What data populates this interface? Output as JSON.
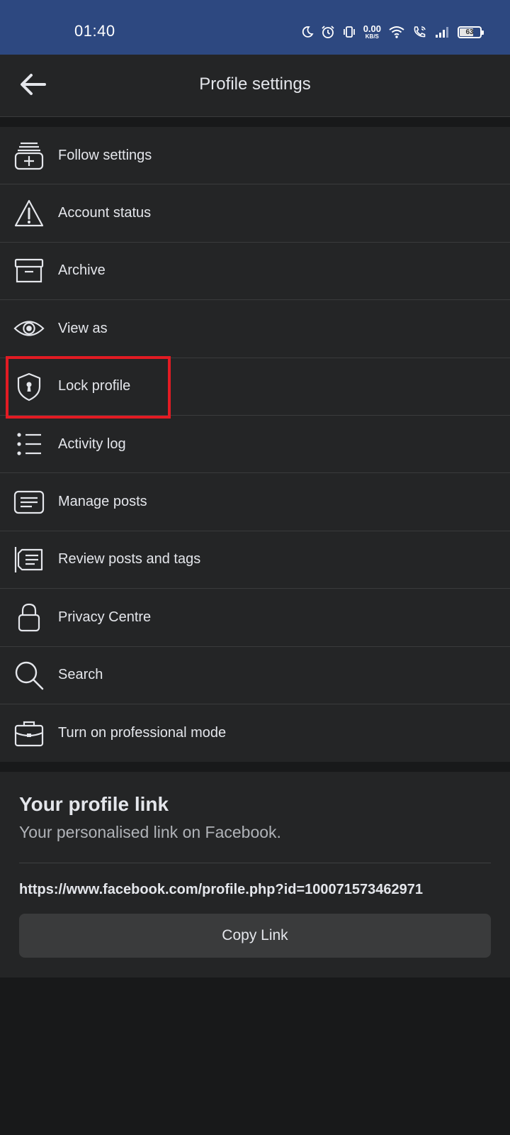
{
  "status_bar": {
    "time": "01:40",
    "net_speed_value": "0.00",
    "net_speed_unit": "KB/S",
    "battery": "63",
    "icons": [
      "moon-icon",
      "alarm-icon",
      "vibrate-icon",
      "wifi-icon",
      "wifi-calling-icon",
      "signal-icon",
      "battery-icon"
    ]
  },
  "header": {
    "title": "Profile settings",
    "back_icon": "arrow-left-icon"
  },
  "menu": {
    "items": [
      {
        "label": "Follow settings",
        "icon": "follow-settings-icon"
      },
      {
        "label": "Account status",
        "icon": "warning-icon"
      },
      {
        "label": "Archive",
        "icon": "archive-icon"
      },
      {
        "label": "View as",
        "icon": "eye-icon"
      },
      {
        "label": "Lock profile",
        "icon": "shield-lock-icon"
      },
      {
        "label": "Activity log",
        "icon": "list-icon"
      },
      {
        "label": "Manage posts",
        "icon": "posts-icon"
      },
      {
        "label": "Review posts and tags",
        "icon": "review-tags-icon"
      },
      {
        "label": "Privacy Centre",
        "icon": "lock-icon"
      },
      {
        "label": "Search",
        "icon": "search-icon"
      },
      {
        "label": "Turn on professional mode",
        "icon": "briefcase-icon"
      }
    ]
  },
  "profile_link": {
    "title": "Your profile link",
    "subtitle": "Your personalised link on Facebook.",
    "url": "https://www.facebook.com/profile.php?id=100071573462971",
    "copy_label": "Copy Link"
  },
  "colors": {
    "status_bar": "#2d4880",
    "surface": "#242526",
    "background": "#18191a",
    "highlight": "#e21b23"
  }
}
